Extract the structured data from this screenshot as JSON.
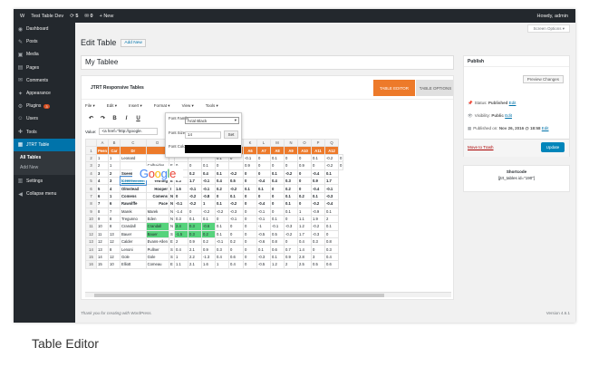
{
  "adminbar": {
    "wp": "W",
    "site": "Test Table Dev",
    "updates": "5",
    "comments": "0",
    "new": "+ New",
    "howdy": "Howdy, admin"
  },
  "sidebar": {
    "items": [
      {
        "icon": "◉",
        "label": "Dashboard"
      },
      {
        "icon": "✎",
        "label": "Posts"
      },
      {
        "icon": "▣",
        "label": "Media"
      },
      {
        "icon": "▤",
        "label": "Pages"
      },
      {
        "icon": "✉",
        "label": "Comments"
      },
      {
        "icon": "✦",
        "label": "Appearance"
      },
      {
        "icon": "⚙",
        "label": "Plugins",
        "badge": "3"
      },
      {
        "icon": "☺",
        "label": "Users"
      },
      {
        "icon": "✚",
        "label": "Tools"
      },
      {
        "icon": "▦",
        "label": "JTRT Table"
      }
    ],
    "sub": [
      "All Tables",
      "Add New"
    ],
    "items2": [
      {
        "icon": "▥",
        "label": "Settings"
      },
      {
        "icon": "◀",
        "label": "Collapse menu"
      }
    ]
  },
  "screen_options": "Screen Options ▾",
  "page": {
    "heading": "Edit Table",
    "add_new": "Add New",
    "title_value": "My Tablee"
  },
  "editor": {
    "title": "JTRT Responsive Tables",
    "tab_editor": "TABLE EDITOR",
    "tab_options": "TABLE OPTIONS",
    "menus": [
      "File ▾",
      "Edit ▾",
      "Insert ▾",
      "Format ▾",
      "View ▾",
      "Tools ▾"
    ],
    "toolbar": [
      "↶",
      "↷",
      "B",
      "I",
      "U"
    ],
    "value_label": "Value:",
    "value_text": "<a href=\"http://google.",
    "font_panel": {
      "family_label": "Font Family",
      "family_value": "Arial Black",
      "size_label": "Font Size",
      "size_value": "14",
      "set": "Set",
      "color_label": "Font Color"
    },
    "google": "Google",
    "cols": [
      "",
      "A",
      "B",
      "C",
      "D",
      "E",
      "F",
      "G",
      "H",
      "I",
      "J",
      "K",
      "L",
      "M",
      "N",
      "O",
      "P",
      "Q"
    ],
    "rows": [
      {
        "n": "1",
        "cls": "hdr",
        "cells": [
          "Peen",
          "Car",
          "Dr",
          "",
          "",
          "A1",
          "A2",
          "A3",
          "A4",
          "A5",
          "A6",
          "A7",
          "A8",
          "A9",
          "A10",
          "A11",
          "A12"
        ]
      },
      {
        "n": "2",
        "cells": [
          "1",
          "1",
          "Leonard",
          "",
          "",
          "",
          "",
          "",
          "0.1",
          "0",
          "-0.1",
          "0",
          "0.1",
          "0",
          "0",
          "0.1",
          "-0.2",
          "0"
        ]
      },
      {
        "n": "3",
        "cells": [
          "2",
          "1",
          "",
          "Calbaidos",
          "E",
          "0",
          "0",
          "0.1",
          "0",
          "",
          "0.9",
          "0",
          "0",
          "0",
          "0.9",
          "0",
          "-0.2",
          "0"
        ]
      },
      {
        "n": "4",
        "cls": "b",
        "cells": [
          "3",
          "2",
          "Sseenmeyer",
          "Parry",
          "E",
          "0.7",
          "0.2",
          "0.4",
          "0.1",
          "-0.2",
          "0",
          "0",
          "0.1",
          "-0.2",
          "0",
          "-0.4",
          "0.1"
        ]
      },
      {
        "n": "5",
        "cls": "b sel",
        "cells": [
          "4",
          "3",
          "Iceeeeeeeeel",
          "Yetning",
          "E",
          "0.3",
          "1.7",
          "-0.1",
          "0.4",
          "0.5",
          "0",
          "-0.4",
          "0.4",
          "0.3",
          "0",
          "0.9",
          "1.7"
        ]
      },
      {
        "n": "6",
        "cls": "b",
        "cells": [
          "5",
          "4",
          "Olmstead",
          "Hooper",
          "I",
          "1.6",
          "-0.1",
          "-0.1",
          "0.2",
          "-0.2",
          "0.1",
          "0.1",
          "0",
          "0.2",
          "0",
          "-0.4",
          "-0.1"
        ]
      },
      {
        "n": "7",
        "cls": "b",
        "cells": [
          "6",
          "1",
          "Comens",
          "Comens",
          "N",
          "0",
          "-0.2",
          "-0.8",
          "0",
          "0.1",
          "0",
          "0",
          "0",
          "0.1",
          "0.2",
          "0.1",
          "-0.3"
        ]
      },
      {
        "n": "8",
        "cls": "b",
        "cells": [
          "7",
          "6",
          "Rawolffe",
          "Pace",
          "N",
          "-0.1",
          "-0.2",
          "1",
          "0.1",
          "-0.2",
          "0",
          "-0.4",
          "0",
          "0.1",
          "0",
          "-0.2",
          "-0.4"
        ]
      },
      {
        "n": "9",
        "cells": [
          "8",
          "7",
          "Marek",
          "Marek",
          "N",
          "-1.4",
          "0",
          "-0.2",
          "-0.2",
          "-0.3",
          "0",
          "-0.1",
          "0",
          "0.1",
          "1",
          "-0.9",
          "0.1"
        ]
      },
      {
        "n": "10",
        "cells": [
          "9",
          "8",
          "Tregunno",
          "Eden",
          "N",
          "0.3",
          "0.1",
          "0.1",
          "0",
          "-0.1",
          "0",
          "-0.1",
          "0.1",
          "0",
          "1.1",
          "1.9",
          "2"
        ]
      },
      {
        "n": "11",
        "cls": "grn",
        "cells": [
          "10",
          "8",
          "Crandall",
          "Crandall",
          "N",
          "2.4",
          "0.3",
          "-0.6",
          "0.1",
          "0",
          "0",
          "-1",
          "-0.1",
          "-0.3",
          "1.2",
          "-0.2",
          "0.1"
        ]
      },
      {
        "n": "12",
        "cls": "grn",
        "cells": [
          "11",
          "13",
          "Bauer",
          "Bauer",
          "S",
          "-1.5",
          "0.3",
          "0.2",
          "0.1",
          "0",
          "0",
          "-0.5",
          "0.5",
          "-0.2",
          "1.7",
          "-0.3",
          "0"
        ]
      },
      {
        "n": "13",
        "cells": [
          "12",
          "12",
          "Calder",
          "Evans-Allen",
          "E",
          "2",
          "0.9",
          "0.2",
          "-0.1",
          "0.2",
          "0",
          "-0.6",
          "0.8",
          "0",
          "0.4",
          "0.3",
          "0.8"
        ]
      },
      {
        "n": "14",
        "cells": [
          "13",
          "8",
          "Lenoni",
          "Pullner",
          "S",
          "0.4",
          "2.1",
          "0.9",
          "0.3",
          "0",
          "0",
          "0.1",
          "0.6",
          "0.7",
          "1.4",
          "0",
          "0.3"
        ]
      },
      {
        "n": "15",
        "cells": [
          "14",
          "12",
          "Gole",
          "Gole",
          "S",
          "1",
          "2.2",
          "-1.3",
          "0.4",
          "0.6",
          "0",
          "-0.3",
          "0.1",
          "0.9",
          "2.8",
          "3",
          "0.4"
        ]
      },
      {
        "n": "16",
        "cells": [
          "15",
          "10",
          "Elliott",
          "Comeau",
          "E",
          "1.1",
          "2.1",
          "1.6",
          "1",
          "0.4",
          "0",
          "-0.5",
          "1.2",
          "2",
          "2.5",
          "0.5",
          "0.6"
        ]
      }
    ]
  },
  "publish": {
    "title": "Publish",
    "preview": "Preview Changes",
    "status_label": "Status:",
    "status": "Published",
    "edit": "Edit",
    "visibility_label": "Visibility:",
    "visibility": "Public",
    "published_label": "Published on:",
    "published_date": "Nov 26, 2016 @ 18:58",
    "trash": "Move to Trash",
    "update": "Update"
  },
  "shortcode": {
    "title": "Shortcode",
    "code": "[jtrt_tables id=\"190\"]"
  },
  "footer": {
    "thanks": "Thank you for creating with WordPress.",
    "version": "Version 4.6.1"
  },
  "caption": "Table Editor"
}
